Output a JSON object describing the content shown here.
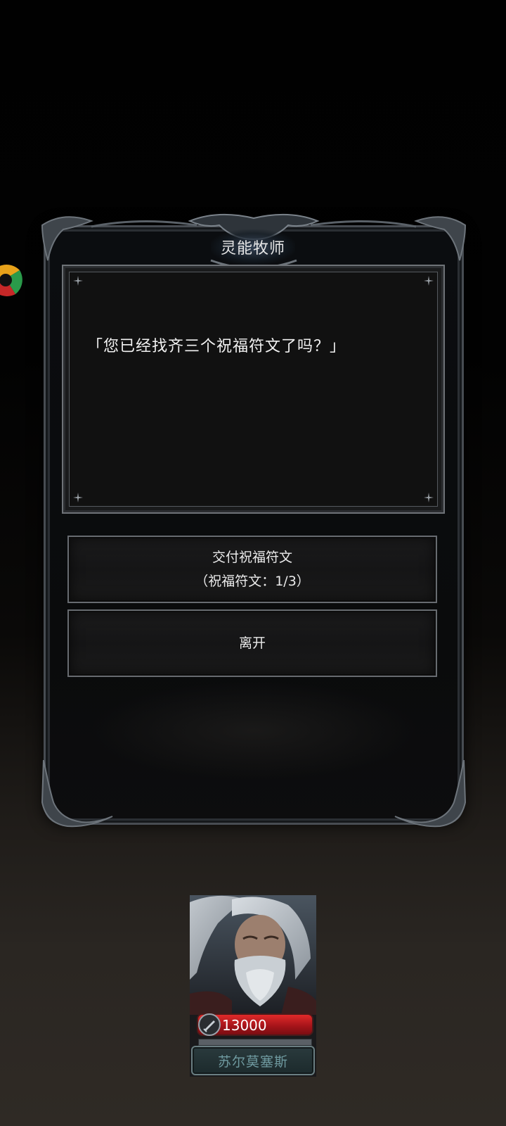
{
  "dialog": {
    "speaker_title": "灵能牧师",
    "message": "「您已经找齐三个祝福符文了吗？」"
  },
  "options": [
    {
      "line1": "交付祝福符文",
      "line2": "（祝福符文：1/3）"
    },
    {
      "line1": "离开",
      "line2": ""
    }
  ],
  "hero": {
    "hp": "13000",
    "name": "苏尔莫塞斯",
    "hp_color": "#c81e22",
    "name_color": "#6f9aa0"
  },
  "icons": {
    "side_logo": "colorful-app-logo-icon",
    "hp_icon": "sword-emblem-icon"
  }
}
